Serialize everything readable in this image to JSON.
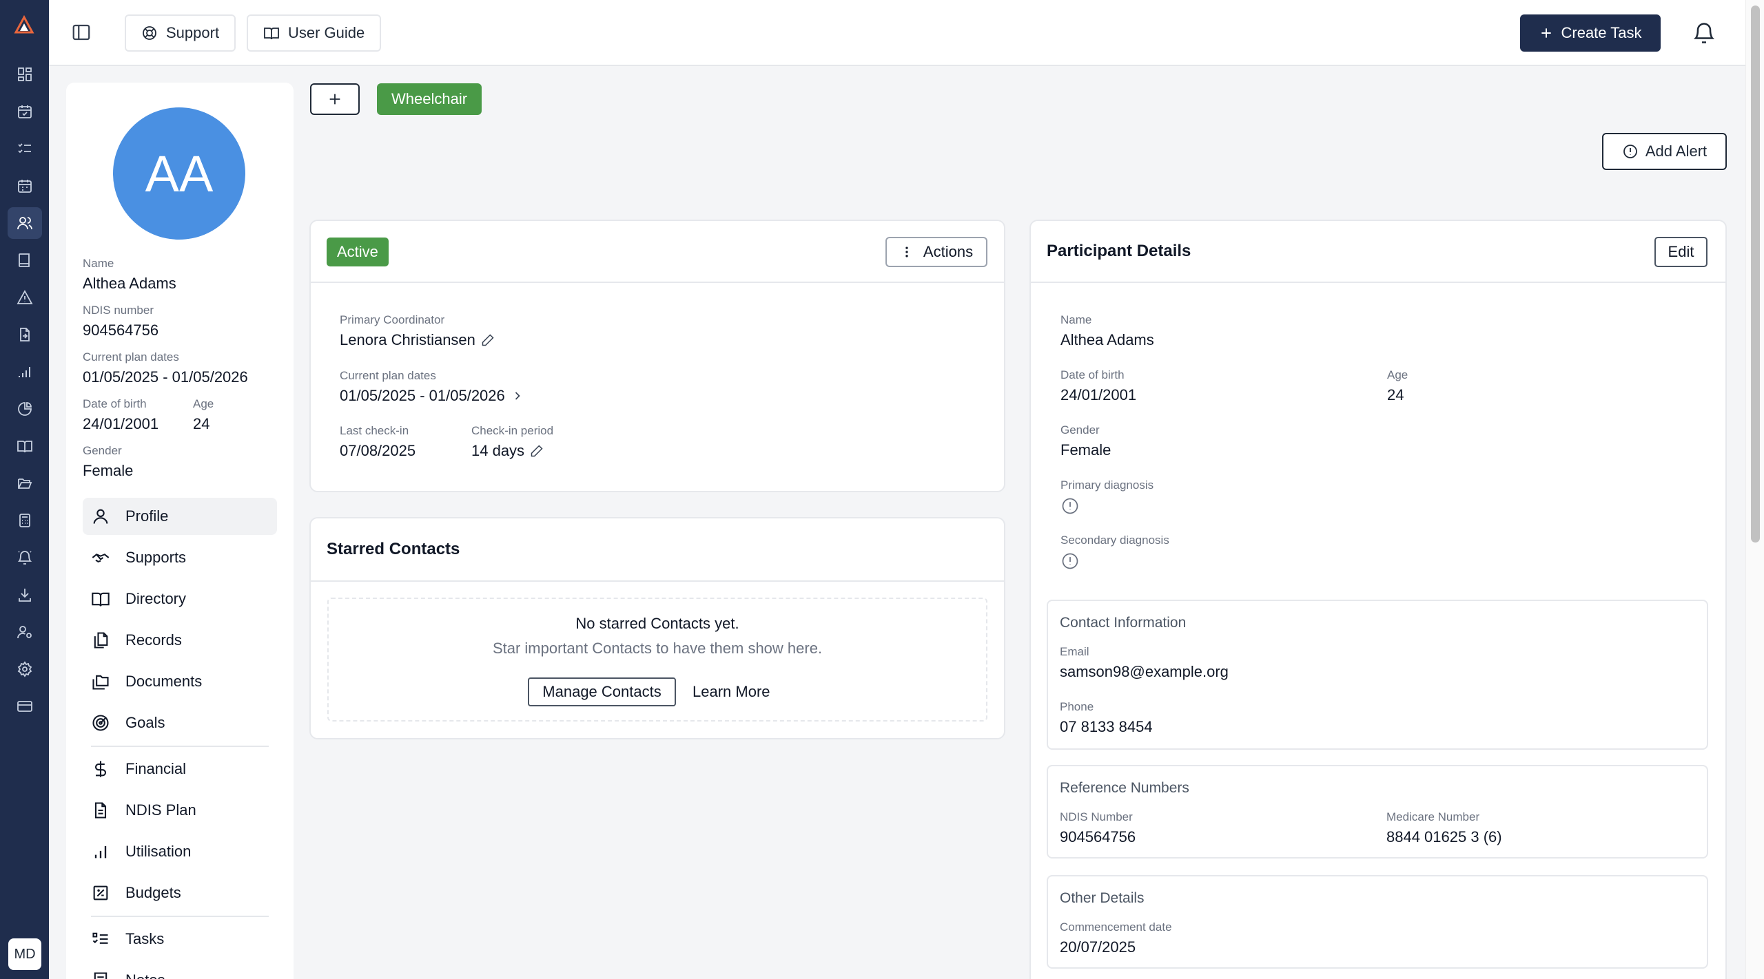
{
  "topbar": {
    "support_label": "Support",
    "user_guide_label": "User Guide",
    "create_task_label": "Create Task"
  },
  "user": {
    "initials": "MD"
  },
  "profile": {
    "initials": "AA",
    "name_label": "Name",
    "name": "Althea Adams",
    "ndis_label": "NDIS number",
    "ndis": "904564756",
    "plan_label": "Current plan dates",
    "plan": "01/05/2025 - 01/05/2026",
    "dob_label": "Date of birth",
    "dob": "24/01/2001",
    "age_label": "Age",
    "age": "24",
    "gender_label": "Gender",
    "gender": "Female"
  },
  "nav": [
    {
      "label": "Profile",
      "icon": "user-icon"
    },
    {
      "label": "Supports",
      "icon": "handshake-icon"
    },
    {
      "label": "Directory",
      "icon": "book-open-icon"
    },
    {
      "label": "Records",
      "icon": "files-icon"
    },
    {
      "label": "Documents",
      "icon": "folders-icon"
    },
    {
      "label": "Goals",
      "icon": "target-icon"
    },
    {
      "label": "Financial",
      "icon": "dollar-icon"
    },
    {
      "label": "NDIS Plan",
      "icon": "document-icon"
    },
    {
      "label": "Utilisation",
      "icon": "bar-chart-icon"
    },
    {
      "label": "Budgets",
      "icon": "calculator-icon"
    },
    {
      "label": "Tasks",
      "icon": "list-checks-icon"
    },
    {
      "label": "Notes",
      "icon": "notes-icon"
    }
  ],
  "tags": {
    "wheelchair": "Wheelchair"
  },
  "add_alert_label": "Add Alert",
  "status_card": {
    "status": "Active",
    "actions_label": "Actions",
    "coordinator_label": "Primary Coordinator",
    "coordinator": "Lenora Christiansen",
    "plan_label": "Current plan dates",
    "plan": "01/05/2025 - 01/05/2026",
    "last_checkin_label": "Last check-in",
    "last_checkin": "07/08/2025",
    "period_label": "Check-in period",
    "period": "14 days"
  },
  "starred": {
    "title": "Starred Contacts",
    "empty_title": "No starred Contacts yet.",
    "empty_sub": "Star important Contacts to have them show here.",
    "manage_label": "Manage Contacts",
    "learn_label": "Learn More"
  },
  "details": {
    "title": "Participant Details",
    "edit_label": "Edit",
    "name_label": "Name",
    "name": "Althea Adams",
    "dob_label": "Date of birth",
    "dob": "24/01/2001",
    "age_label": "Age",
    "age": "24",
    "gender_label": "Gender",
    "gender": "Female",
    "primary_diag_label": "Primary diagnosis",
    "secondary_diag_label": "Secondary diagnosis",
    "contact": {
      "title": "Contact Information",
      "email_label": "Email",
      "email": "samson98@example.org",
      "phone_label": "Phone",
      "phone": "07 8133 8454"
    },
    "refs": {
      "title": "Reference Numbers",
      "ndis_label": "NDIS Number",
      "ndis": "904564756",
      "medicare_label": "Medicare Number",
      "medicare": "8844 01625 3 (6)"
    },
    "other": {
      "title": "Other Details",
      "commencement_label": "Commencement date",
      "commencement": "20/07/2025"
    }
  }
}
